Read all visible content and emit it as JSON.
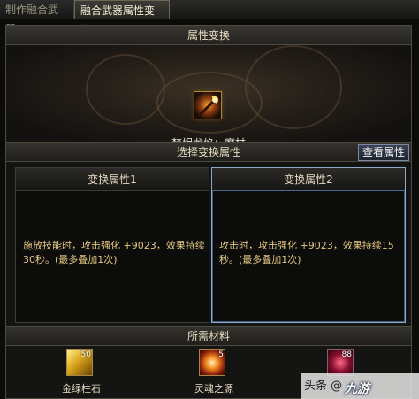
{
  "tabs": [
    {
      "label": "制作融合武器"
    },
    {
      "label": "融合武器属性变换"
    }
  ],
  "panel": {
    "title": "属性变换",
    "weapon_name": "焚烬龙焰：魔杖",
    "select_header": "选择变换属性",
    "view_button": "查看属性",
    "options": [
      {
        "title": "变换属性1",
        "text": "施放技能时，攻击强化 +9023，效果持续30秒。(最多叠加1次)"
      },
      {
        "title": "变换属性2",
        "text": "攻击时，攻击强化 +9023，效果持续15秒。(最多叠加1次)"
      }
    ],
    "materials_header": "所需材料",
    "materials": [
      {
        "name": "金绿柱石",
        "count": "50"
      },
      {
        "name": "灵魂之源",
        "count": "5"
      },
      {
        "name": "",
        "count": "88"
      }
    ]
  },
  "watermark": {
    "text": "头条 @",
    "logo": "九游"
  }
}
